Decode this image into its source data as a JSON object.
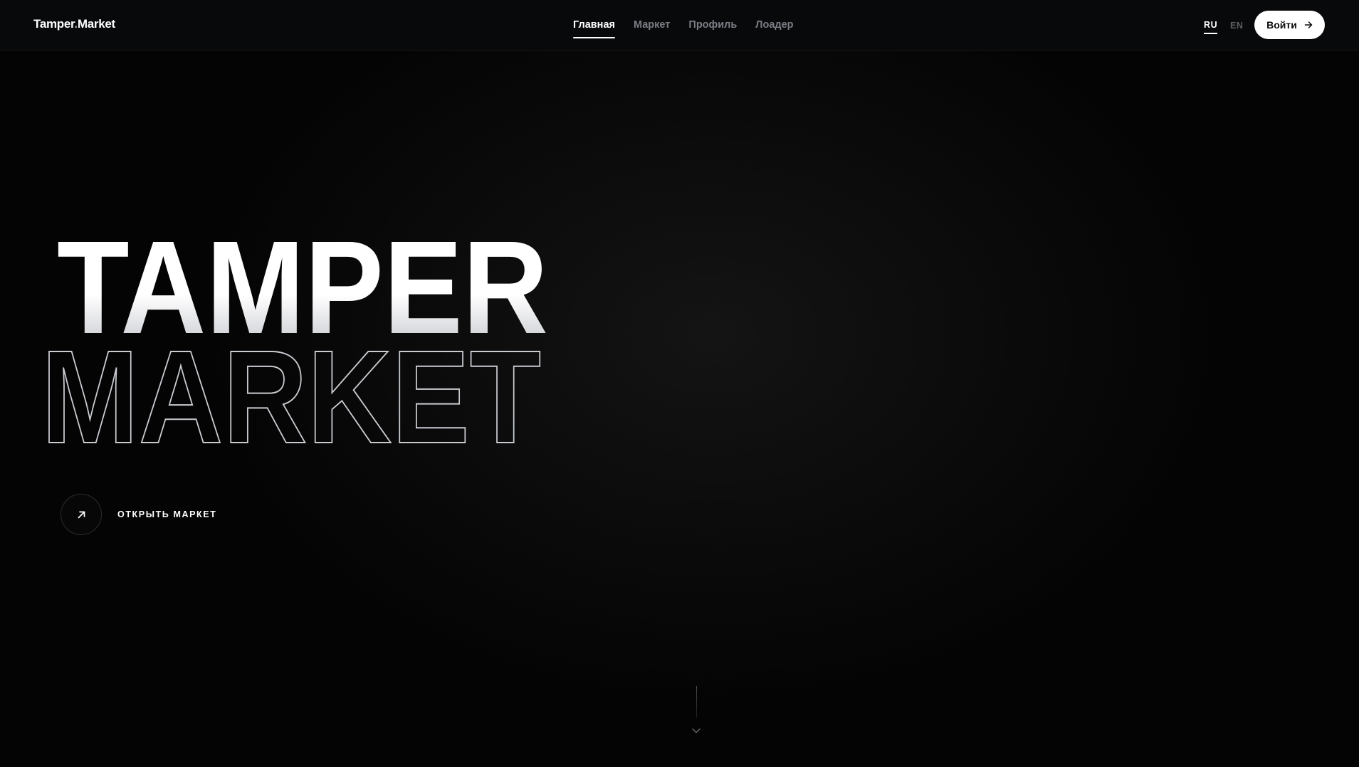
{
  "header": {
    "logo": {
      "part1": "Tamper",
      "dot": ".",
      "part2": "Market"
    },
    "nav": [
      {
        "label": "Главная",
        "active": true
      },
      {
        "label": "Маркет",
        "active": false
      },
      {
        "label": "Профиль",
        "active": false
      },
      {
        "label": "Лоадер",
        "active": false
      }
    ],
    "languages": [
      {
        "code": "RU",
        "active": true
      },
      {
        "code": "EN",
        "active": false
      }
    ],
    "login_label": "Войти",
    "login_icon": "arrow-right-icon"
  },
  "hero": {
    "title_line1": "TAMPER",
    "title_line2": "MARKET",
    "cta_label": "ОТКРЫТЬ МАРКЕТ",
    "cta_icon": "arrow-up-right-icon"
  },
  "scroll_indicator_icon": "chevron-down-icon",
  "colors": {
    "background": "#030303",
    "header_bg": "#08090b",
    "text": "#ffffff",
    "nav_inactive": "#7b7e84"
  }
}
